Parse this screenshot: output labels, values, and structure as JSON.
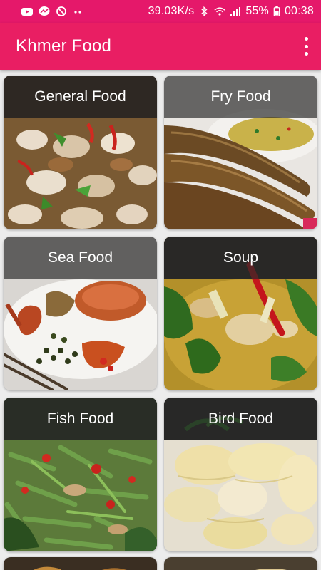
{
  "status_bar": {
    "speed": "39.03K/s",
    "battery": "55%",
    "time": "00:38",
    "icons": [
      "youtube-icon",
      "messenger-icon",
      "blocked-icon",
      "more-dots-icon",
      "bluetooth-icon",
      "wifi-icon",
      "signal-icon",
      "battery-icon"
    ]
  },
  "app_bar": {
    "title": "Khmer Food",
    "menu_icon": "overflow-menu-icon"
  },
  "categories": [
    {
      "label": "General Food"
    },
    {
      "label": "Fry Food"
    },
    {
      "label": "Sea Food"
    },
    {
      "label": "Soup"
    },
    {
      "label": "Fish Food"
    },
    {
      "label": "Bird Food"
    }
  ],
  "colors": {
    "status_bar": "#e5186a",
    "app_bar": "#e91e63",
    "background": "#ececec"
  }
}
